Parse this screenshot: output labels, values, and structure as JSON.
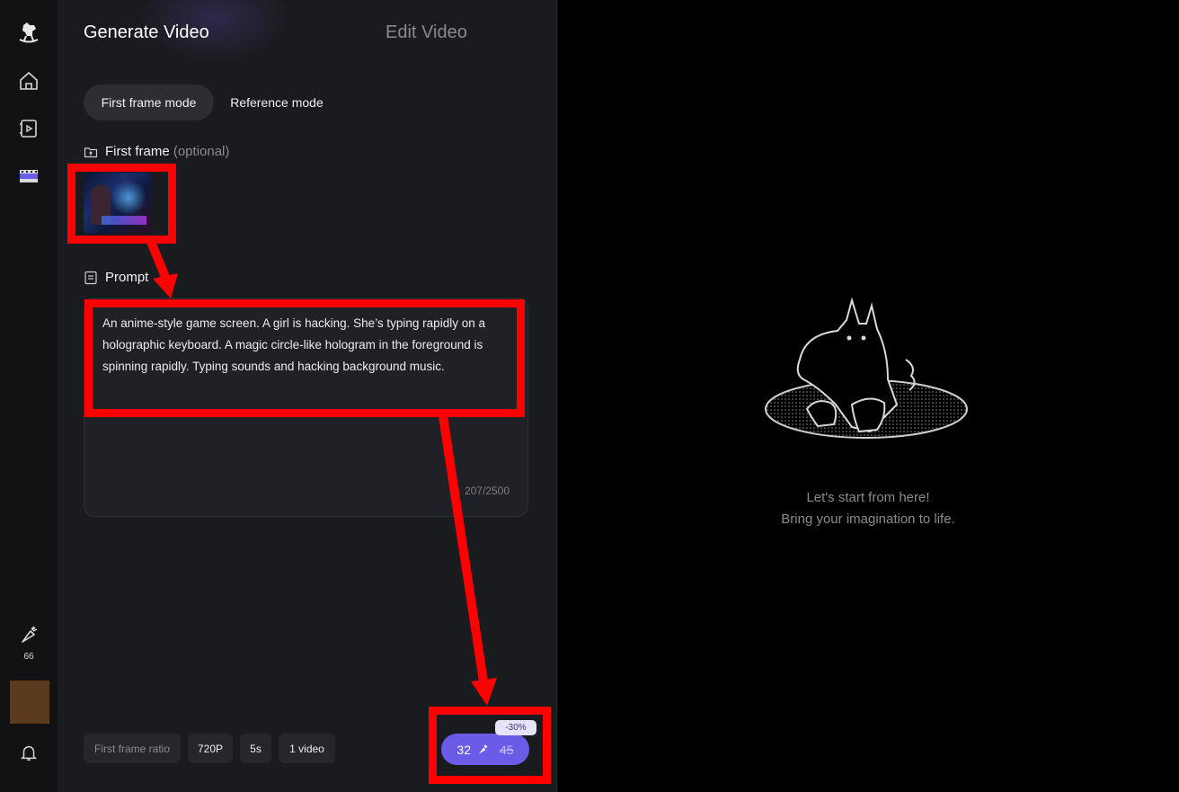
{
  "sidebar": {
    "logo_icon": "rocking-horse-icon",
    "items": [
      {
        "name": "home",
        "icon": "home-icon"
      },
      {
        "name": "video",
        "icon": "video-play-icon"
      },
      {
        "name": "film",
        "icon": "film-strip-icon"
      }
    ],
    "credits": {
      "icon": "carrot-icon",
      "count": "66"
    },
    "avatar_color": "#5c3a1e",
    "bell_icon": "bell-icon"
  },
  "tabs": {
    "generate": "Generate Video",
    "edit": "Edit Video"
  },
  "modes": {
    "first_frame": "First frame mode",
    "reference": "Reference mode"
  },
  "first_frame": {
    "label": "First frame",
    "optional": "(optional)",
    "icon": "folder-upload-icon"
  },
  "prompt": {
    "label": "Prompt",
    "icon": "document-icon",
    "text": "An anime-style game screen. A girl is hacking. She’s typing rapidly on a holographic keyboard. A magic circle-like hologram in the foreground is spinning rapidly. Typing sounds and hacking background music.",
    "count": "207/2500"
  },
  "options": {
    "ratio": "First frame ratio",
    "resolution": "720P",
    "duration": "5s",
    "count": "1 video"
  },
  "generate": {
    "cost": "32",
    "old_cost": "45",
    "discount": "-30%",
    "icon": "carrot-icon"
  },
  "empty_state": {
    "line1": "Let's start from here!",
    "line2": "Bring your imagination to life."
  },
  "colors": {
    "accent": "#6b5ce7",
    "highlight": "#ff0000",
    "panel": "#1a1b1e"
  }
}
